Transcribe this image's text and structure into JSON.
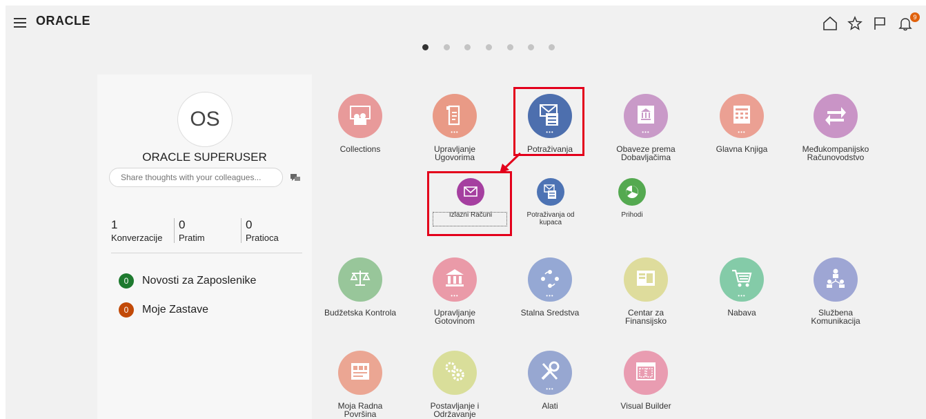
{
  "header": {
    "logo": "ORACLE",
    "notification_count": "9"
  },
  "carousel": {
    "pages": 7,
    "active": 0
  },
  "profile": {
    "initials": "OS",
    "name": "ORACLE SUPERUSER",
    "share_placeholder": "Share thoughts with your colleagues...",
    "stats": [
      {
        "value": "1",
        "label": "Konverzacije"
      },
      {
        "value": "0",
        "label": "Pratim"
      },
      {
        "value": "0",
        "label": "Pratioca"
      }
    ],
    "feeds": [
      {
        "count": "0",
        "label": "Novosti za Zaposlenike",
        "color": "#1e7a2f"
      },
      {
        "count": "0",
        "label": "Moje Zastave",
        "color": "#c24a08"
      }
    ]
  },
  "apps": {
    "collections": "Collections",
    "upravljanje_ugovorima": [
      "Upravljanje",
      "Ugovorima"
    ],
    "potrazivanja": "Potraživanja",
    "obaveze": [
      "Obaveze prema",
      "Dobavljačima"
    ],
    "glavna_knjiga": "Glavna Knjiga",
    "medjukompanijsko": [
      "Međukompanijsko",
      "Računovodstvo"
    ],
    "budzetska": "Budžetska Kontrola",
    "gotovina": [
      "Upravljanje",
      "Gotovinom"
    ],
    "stalna": "Stalna Sredstva",
    "centar": [
      "Centar za",
      "Finansijsko"
    ],
    "nabava": "Nabava",
    "sluzbena": [
      "Službena",
      "Komunikacija"
    ],
    "radna": [
      "Moja Radna",
      "Površina"
    ],
    "postavljanje": [
      "Postavljanje i",
      "Održavanje"
    ],
    "alati": "Alati",
    "visual_builder": "Visual Builder"
  },
  "subapps": {
    "izlazni": "Izlazni Računi",
    "kupci": [
      "Potraživanja od",
      "kupaca"
    ],
    "prihodi": "Prihodi"
  },
  "colors": {
    "collections": "#e89a9a",
    "ugovori": "#e99a86",
    "potrazivanja": "#4d6fae",
    "obaveze": "#c99ac8",
    "knjiga": "#eba093",
    "medju": "#c994c6",
    "budzet": "#98c69a",
    "gotovina": "#ea9aa8",
    "stalna": "#95a8d4",
    "centar": "#dedc9c",
    "nabava": "#84cba8",
    "sluzbena": "#9ea6d4",
    "radna": "#eba693",
    "postavljanje": "#d9de9a",
    "alati": "#97a7d1",
    "visual": "#e99cb1",
    "izlazni": "#a53fa0",
    "kupci": "#4d73b4",
    "prihodi": "#54a950",
    "highlight": "#e3001b"
  }
}
